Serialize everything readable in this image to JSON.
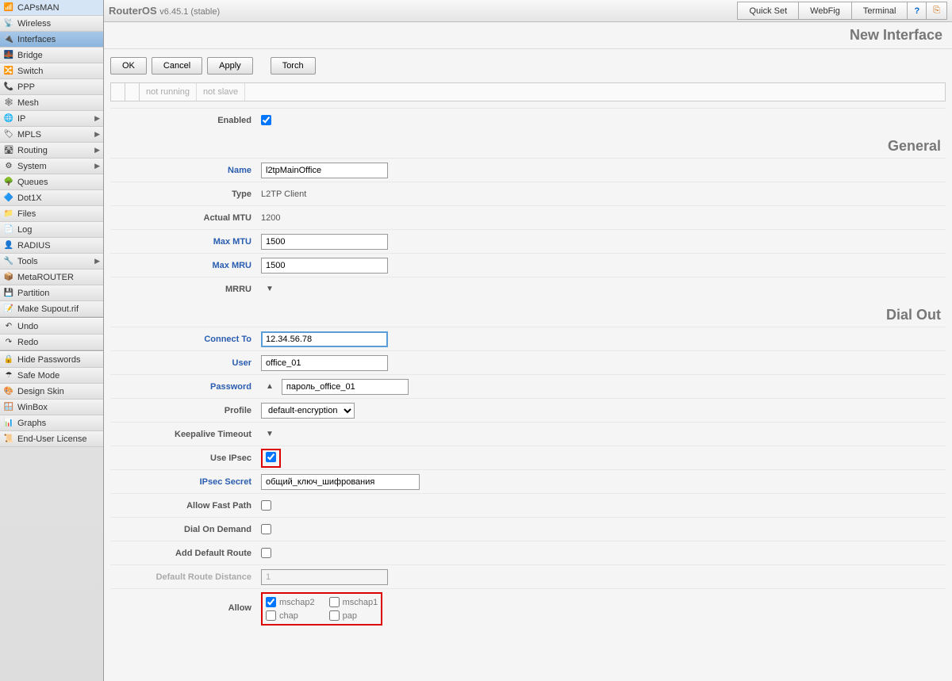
{
  "header": {
    "product": "RouterOS",
    "version": "v6.45.1 (stable)"
  },
  "topbuttons": {
    "quickset": "Quick Set",
    "webfig": "WebFig",
    "terminal": "Terminal"
  },
  "page_title": "New Interface",
  "sidebar": [
    {
      "label": "CAPsMAN",
      "icon": "📶"
    },
    {
      "label": "Wireless",
      "icon": "📡"
    },
    {
      "label": "Interfaces",
      "icon": "🔌",
      "active": true
    },
    {
      "label": "Bridge",
      "icon": "🌉"
    },
    {
      "label": "Switch",
      "icon": "🔀"
    },
    {
      "label": "PPP",
      "icon": "📞"
    },
    {
      "label": "Mesh",
      "icon": "🕸"
    },
    {
      "label": "IP",
      "icon": "🌐",
      "sub": true
    },
    {
      "label": "MPLS",
      "icon": "🏷",
      "sub": true
    },
    {
      "label": "Routing",
      "icon": "🛣",
      "sub": true
    },
    {
      "label": "System",
      "icon": "⚙",
      "sub": true
    },
    {
      "label": "Queues",
      "icon": "🌳"
    },
    {
      "label": "Dot1X",
      "icon": "🔷"
    },
    {
      "label": "Files",
      "icon": "📁"
    },
    {
      "label": "Log",
      "icon": "📄"
    },
    {
      "label": "RADIUS",
      "icon": "👤"
    },
    {
      "label": "Tools",
      "icon": "🔧",
      "sub": true
    },
    {
      "label": "MetaROUTER",
      "icon": "📦"
    },
    {
      "label": "Partition",
      "icon": "💾"
    },
    {
      "label": "Make Supout.rif",
      "icon": "📝"
    },
    {
      "sep": true
    },
    {
      "label": "Undo",
      "icon": "↶"
    },
    {
      "label": "Redo",
      "icon": "↷"
    },
    {
      "sep": true
    },
    {
      "label": "Hide Passwords",
      "icon": "🔒"
    },
    {
      "label": "Safe Mode",
      "icon": "☂"
    },
    {
      "label": "Design Skin",
      "icon": "🎨"
    },
    {
      "label": "WinBox",
      "icon": "🪟"
    },
    {
      "label": "Graphs",
      "icon": "📊"
    },
    {
      "label": "End-User License",
      "icon": "📜"
    }
  ],
  "toolbar": {
    "ok": "OK",
    "cancel": "Cancel",
    "apply": "Apply",
    "torch": "Torch"
  },
  "status": {
    "s1": "not running",
    "s2": "not slave"
  },
  "sections": {
    "general": "General",
    "dialout": "Dial Out"
  },
  "labels": {
    "enabled": "Enabled",
    "name": "Name",
    "type": "Type",
    "actual_mtu": "Actual MTU",
    "max_mtu": "Max MTU",
    "max_mru": "Max MRU",
    "mrru": "MRRU",
    "connect_to": "Connect To",
    "user": "User",
    "password": "Password",
    "profile": "Profile",
    "keepalive": "Keepalive Timeout",
    "use_ipsec": "Use IPsec",
    "ipsec_secret": "IPsec Secret",
    "allow_fast": "Allow Fast Path",
    "dial_on_demand": "Dial On Demand",
    "add_default_route": "Add Default Route",
    "default_route_distance": "Default Route Distance",
    "allow": "Allow"
  },
  "values": {
    "name": "l2tpMainOffice",
    "type": "L2TP Client",
    "actual_mtu": "1200",
    "max_mtu": "1500",
    "max_mru": "1500",
    "connect_to": "12.34.56.78",
    "user": "office_01",
    "password": "пароль_office_01",
    "profile": "default-encryption",
    "ipsec_secret": "общий_ключ_шифрования",
    "default_route_distance": "1"
  },
  "allow_opts": {
    "mschap2": "mschap2",
    "mschap1": "mschap1",
    "chap": "chap",
    "pap": "pap"
  }
}
